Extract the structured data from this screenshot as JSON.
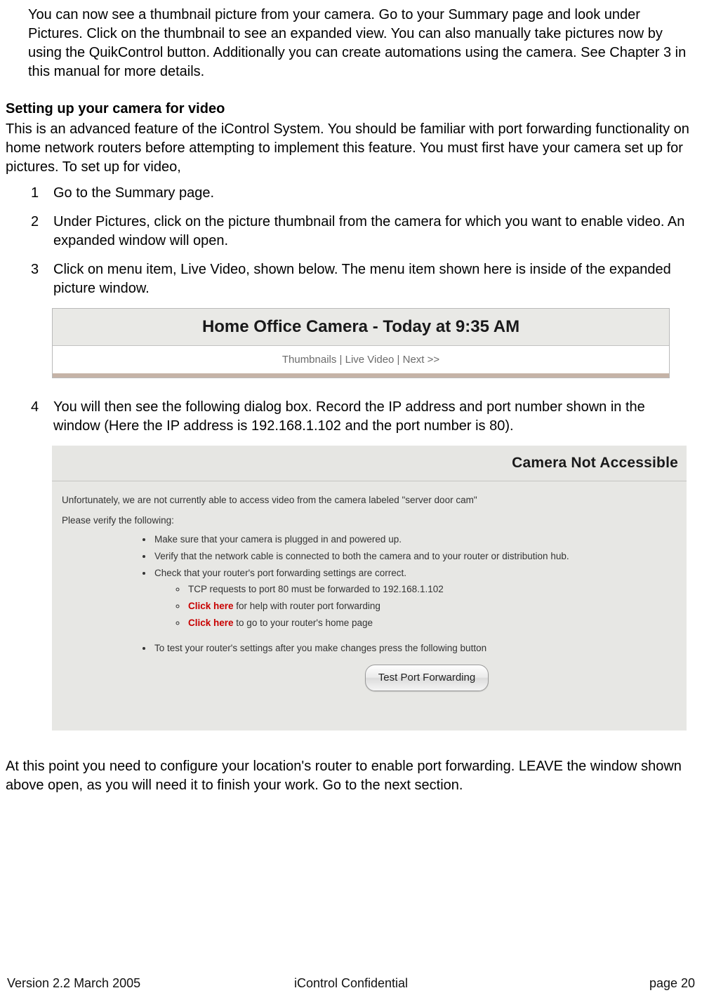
{
  "intro": "You can now see a thumbnail picture from your camera.  Go to your Summary page and look under Pictures.  Click on the thumbnail to see an expanded view. You can also manually take pictures now by using the QuikControl button.  Additionally you can create automations using the camera.    See Chapter 3 in this manual for more details.",
  "section_heading": "Setting up your camera for video",
  "section_intro": "This is an advanced feature of the iControl System.  You should be familiar with port forwarding functionality on home network routers before attempting to implement this feature.  You must first have your camera set up for pictures.  To set up for video,",
  "steps": {
    "s1": "Go to the Summary page.",
    "s2": "Under Pictures, click on the picture thumbnail from the camera for which you want to enable video.  An expanded window will open.",
    "s3": "Click on menu item, Live Video, shown below.  The menu item shown here is inside of the expanded picture window.",
    "s4": "You will then see the following dialog box.  Record the IP address and port number shown in the window (Here the IP address is 192.168.1.102 and the port number is 80)."
  },
  "fig1": {
    "title": "Home Office Camera - Today at 9:35 AM",
    "sub": "Thumbnails | Live Video | Next >>"
  },
  "fig2": {
    "title": "Camera Not Accessible",
    "line1": "Unfortunately, we are not currently able to access video from the camera labeled \"server door cam\"",
    "verify": "Please verify the following:",
    "b1": "Make sure that your camera is plugged in and powered up.",
    "b2": "Verify that the network cable is connected to both the camera and to your router or distribution hub.",
    "b3": "Check that your router's port forwarding settings are correct.",
    "b3a": "TCP requests to port 80 must be forwarded to 192.168.1.102",
    "b3b_red": "Click here",
    "b3b_rest": " for help with router port forwarding",
    "b3c_red": "Click here",
    "b3c_rest": " to go to your router's home page",
    "b4": "To test your router's settings after you make changes press the following button",
    "button": "Test Port Forwarding"
  },
  "closing": "At this point you need to configure your location's router to enable port forwarding.  LEAVE the window shown above open, as you will need it to finish your work.  Go to the next section.",
  "footer": {
    "left": "Version 2.2 March 2005",
    "center": "iControl     Confidential",
    "right": "page 20"
  }
}
